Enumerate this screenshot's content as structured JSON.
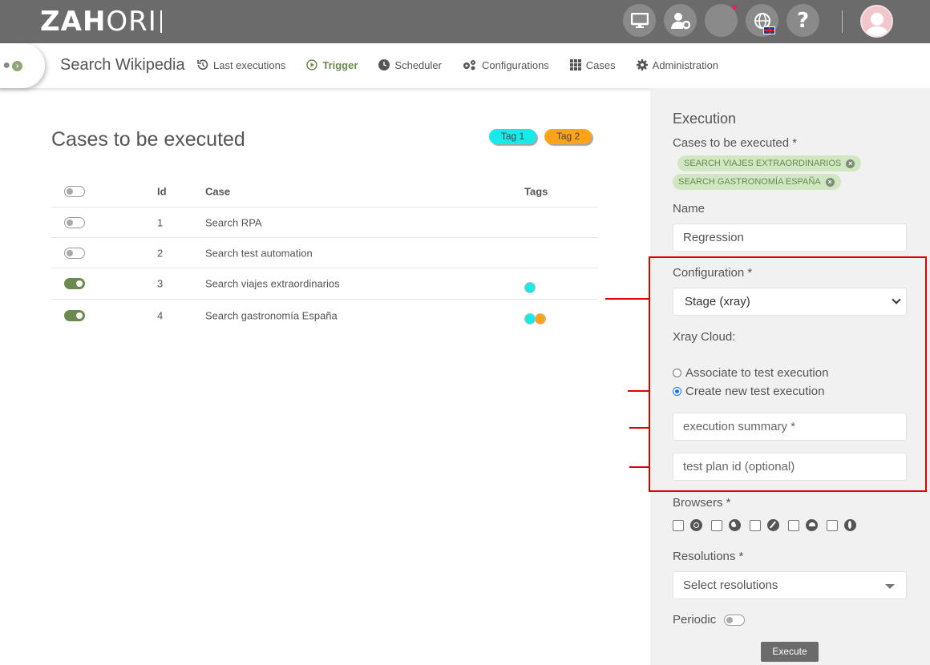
{
  "app": {
    "logo_bold": "ZAH",
    "logo_light": "ORI"
  },
  "nav": {
    "title": "Search Wikipedia",
    "items": [
      {
        "label": "Last executions",
        "icon": "history-icon",
        "active": false
      },
      {
        "label": "Trigger",
        "icon": "play-circle-icon",
        "active": true
      },
      {
        "label": "Scheduler",
        "icon": "clock-icon",
        "active": false
      },
      {
        "label": "Configurations",
        "icon": "gears-icon",
        "active": false
      },
      {
        "label": "Cases",
        "icon": "grid-icon",
        "active": false
      },
      {
        "label": "Administration",
        "icon": "gear-icon",
        "active": false
      }
    ]
  },
  "cases": {
    "title": "Cases to be executed",
    "tags": [
      {
        "label": "Tag 1",
        "color": "#18eaea"
      },
      {
        "label": "Tag 2",
        "color": "#ffa31a"
      }
    ],
    "headers": {
      "id": "Id",
      "case": "Case",
      "tags": "Tags"
    },
    "rows": [
      {
        "id": "1",
        "case": "Search RPA",
        "selected": false,
        "tags": []
      },
      {
        "id": "2",
        "case": "Search test automation",
        "selected": false,
        "tags": []
      },
      {
        "id": "3",
        "case": "Search viajes extraordinarios",
        "selected": true,
        "tags": [
          "#18eaea"
        ]
      },
      {
        "id": "4",
        "case": "Search gastronomía España",
        "selected": true,
        "tags": [
          "#18eaea",
          "#ffa31a"
        ]
      }
    ]
  },
  "execution": {
    "heading": "Execution",
    "cases_label": "Cases to be executed *",
    "selected_cases": [
      "SEARCH VIAJES EXTRAORDINARIOS",
      "SEARCH GASTRONOMÍA ESPAÑA"
    ],
    "name_label": "Name",
    "name_value": "Regression",
    "configuration_label": "Configuration *",
    "configuration_value": "Stage (xray)",
    "xray_label": "Xray Cloud:",
    "radio_associate": "Associate to test execution",
    "radio_create": "Create new test execution",
    "radio_selected": "create",
    "summary_placeholder": "execution summary *",
    "testplan_placeholder": "test plan id (optional)",
    "browsers_label": "Browsers *",
    "browsers": [
      "chrome-icon",
      "firefox-icon",
      "safari-icon",
      "edge-icon",
      "opera-icon"
    ],
    "resolutions_label": "Resolutions *",
    "resolutions_placeholder": "Select resolutions",
    "periodic_label": "Periodic",
    "execute_label": "Execute"
  },
  "colors": {
    "accent": "#6a8a4f",
    "topbar": "#6b6b6b",
    "annotation": "#e00000"
  }
}
